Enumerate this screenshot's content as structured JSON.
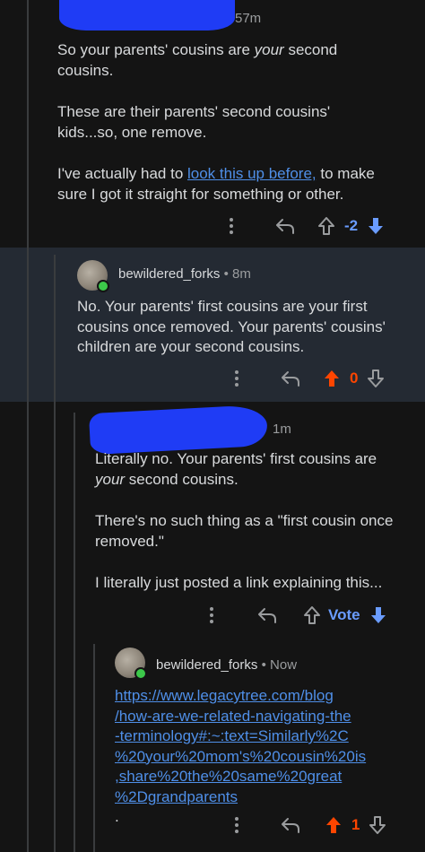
{
  "comments": [
    {
      "time": "57m",
      "paragraphs": [
        "So your parents' cousins are ",
        "These are their parents' second cousins' kids...so, one remove.",
        "I've actually had to "
      ],
      "p1_em": "your",
      "p1_tail": " second cousins.",
      "link_text": "look this up before,",
      "p3_tail": " to make sure I got it straight for something or other.",
      "vote_count": "-2"
    },
    {
      "username": "bewildered_forks",
      "time": "8m",
      "text": "No. Your parents' first cousins are your first cousins once removed. Your parents' cousins' children are your second cousins.",
      "vote_count": "0"
    },
    {
      "time": "1m",
      "p1_head": "Literally no. Your parents' first cousins are ",
      "p1_em": "your",
      "p1_tail": " second cousins.",
      "p2": "There's no such thing as a \"first cousin once removed.\"",
      "p3": "I literally just posted a link explaining this...",
      "vote_label": "Vote"
    },
    {
      "username": "bewildered_forks",
      "time": "Now",
      "link_lines": [
        "https://www.legacytree.com/blog",
        "/how-are-we-related-navigating-the",
        "-terminology#:~:text=Similarly%2C",
        "%20your%20mom's%20cousin%20is",
        ",share%20the%20same%20great",
        "%2Dgrandparents"
      ],
      "link_trailer": ".",
      "vote_count": "1"
    }
  ],
  "separator": "•",
  "colors": {
    "background": "#141414",
    "highlight": "#242a33",
    "link": "#4f8fe8",
    "upvote": "#ff4500",
    "downvote": "#6a9cff",
    "online": "#3cc84a"
  }
}
